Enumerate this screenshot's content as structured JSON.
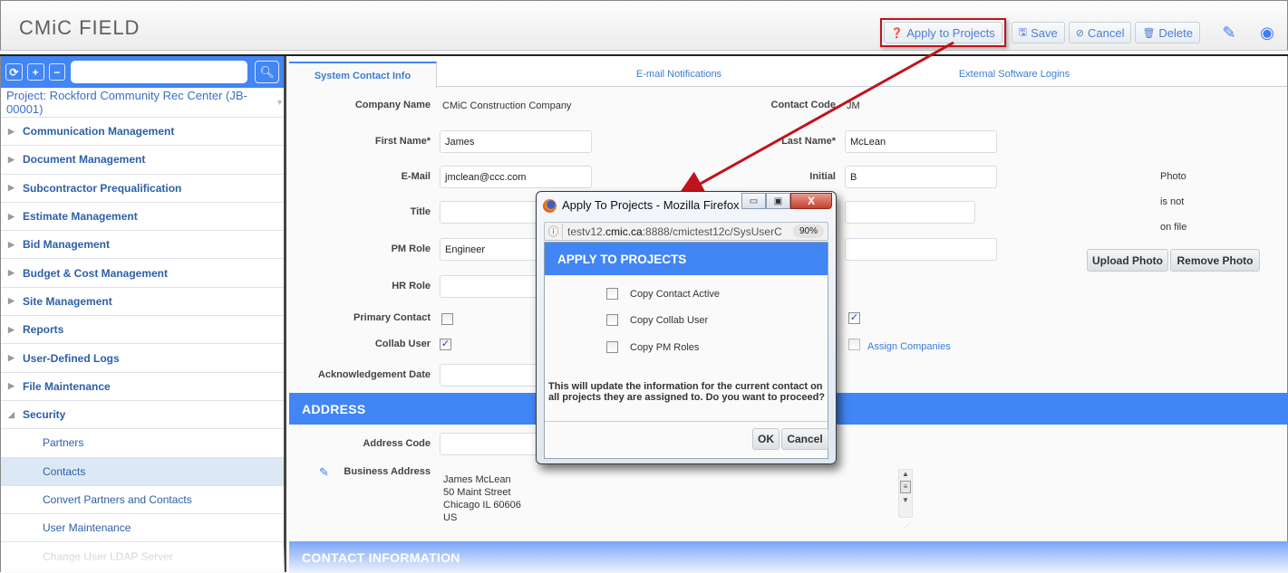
{
  "app": {
    "logo": "CMiC FIELD"
  },
  "toolbar": {
    "apply_label": "Apply to Projects",
    "save_label": "Save",
    "cancel_label": "Cancel",
    "delete_label": "Delete",
    "icons": {
      "apply": "question-circle-icon",
      "save": "floppy-icon",
      "cancel": "ban-icon",
      "delete": "trash-icon",
      "edit": "edit-icon",
      "user": "user-circle-icon"
    }
  },
  "sidebar": {
    "search_placeholder": "",
    "project": "Project: Rockford Community Rec Center (JB-00001)",
    "items": [
      {
        "label": "Communication Management",
        "expanded": false
      },
      {
        "label": "Document Management",
        "expanded": false
      },
      {
        "label": "Subcontractor Prequalification",
        "expanded": false
      },
      {
        "label": "Estimate Management",
        "expanded": false
      },
      {
        "label": "Bid Management",
        "expanded": false
      },
      {
        "label": "Budget & Cost Management",
        "expanded": false
      },
      {
        "label": "Site Management",
        "expanded": false
      },
      {
        "label": "Reports",
        "expanded": false
      },
      {
        "label": "User-Defined Logs",
        "expanded": false
      },
      {
        "label": "File Maintenance",
        "expanded": false
      },
      {
        "label": "Security",
        "expanded": true
      }
    ],
    "subitems": [
      {
        "label": "Partners",
        "active": false
      },
      {
        "label": "Contacts",
        "active": true
      },
      {
        "label": "Convert Partners and Contacts",
        "active": false
      },
      {
        "label": "User Maintenance",
        "active": false
      },
      {
        "label": "Change User LDAP Server",
        "active": false
      }
    ]
  },
  "tabs": [
    {
      "label": "System Contact Info",
      "active": true
    },
    {
      "label": "E-mail Notifications",
      "active": false
    },
    {
      "label": "External Software Logins",
      "active": false
    }
  ],
  "form": {
    "company_name_label": "Company Name",
    "company_name": "CMiC Construction Company",
    "contact_code_label": "Contact Code",
    "contact_code": "JM",
    "first_name_label": "First Name*",
    "first_name": "James",
    "last_name_label": "Last Name*",
    "last_name": "McLean",
    "email_label": "E-Mail",
    "email": "jmclean@ccc.com",
    "initial_label": "Initial",
    "initial": "B",
    "title_label": "Title",
    "title": "",
    "pm_role_label": "PM Role",
    "pm_role": "Engineer",
    "hr_role_label": "HR Role",
    "hr_role": "",
    "primary_contact_label": "Primary Contact",
    "primary_contact": false,
    "collab_user_label": "Collab User",
    "collab_user": true,
    "right_checkbox_checked": true,
    "assign_companies_label": "Assign Companies",
    "assign_companies_checked": false,
    "ack_date_label": "Acknowledgement Date",
    "ack_date": "",
    "photo_line1": "Photo",
    "photo_line2": "is not",
    "photo_line3": "on file",
    "upload_photo": "Upload Photo",
    "remove_photo": "Remove Photo"
  },
  "address": {
    "section_title": "ADDRESS",
    "address_code_label": "Address Code",
    "address_code": "",
    "business_address_label": "Business Address",
    "business_address_lines": [
      "James McLean",
      "50 Maint Street",
      "Chicago IL 60606",
      "US"
    ]
  },
  "contact_info": {
    "section_title": "CONTACT INFORMATION"
  },
  "modal": {
    "window_title": "Apply To Projects - Mozilla Firefox",
    "url_host_prefix": "testv12.",
    "url_host": "cmic.ca",
    "url_rest": ":8888/cmictest12c/SysUserC",
    "zoom": "90%",
    "heading": "APPLY TO PROJECTS",
    "options": [
      {
        "label": "Copy Contact Active",
        "checked": false
      },
      {
        "label": "Copy Collab User",
        "checked": false
      },
      {
        "label": "Copy PM Roles",
        "checked": false
      }
    ],
    "message": "This will update the information for the current contact on all projects they are assigned to. Do you want to proceed?",
    "ok_label": "OK",
    "cancel_label": "Cancel"
  },
  "colors": {
    "accent": "#4285f4",
    "link": "#3a7cd8",
    "annotation": "#c0141c"
  }
}
